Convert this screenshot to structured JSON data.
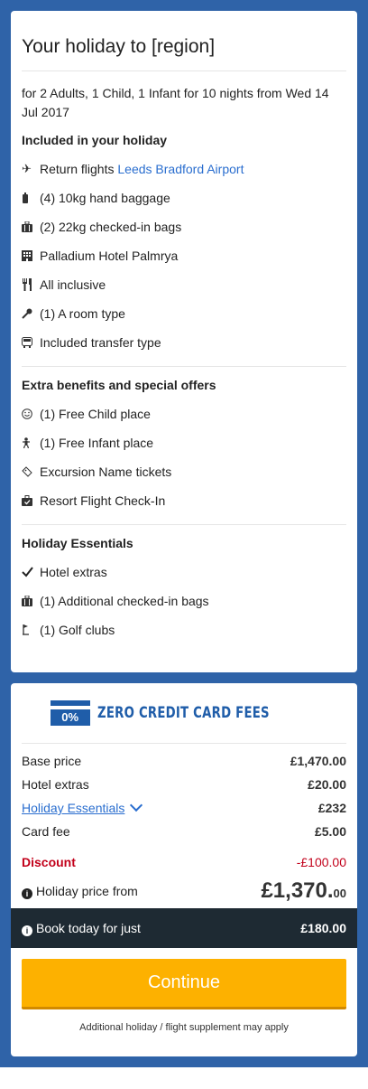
{
  "summary": {
    "title": "Your holiday to [region]",
    "intro": "for 2 Adults, 1 Child, 1 Infant for 10 nights from Wed 14 Jul 2017",
    "included_heading": "Included in your holiday",
    "included": [
      {
        "icon": "plane-icon",
        "text": "Return flights ",
        "link": "Leeds Bradford Airport"
      },
      {
        "icon": "hand-baggage-icon",
        "text": "(4) 10kg hand baggage"
      },
      {
        "icon": "suitcase-icon",
        "text": "(2) 22kg checked-in bags"
      },
      {
        "icon": "hotel-icon",
        "text": "Palladium Hotel Palmrya"
      },
      {
        "icon": "cutlery-icon",
        "text": "All inclusive"
      },
      {
        "icon": "key-icon",
        "text": "(1) A room type"
      },
      {
        "icon": "bus-icon",
        "text": "Included transfer type"
      }
    ],
    "extras_heading": "Extra benefits and special offers",
    "extras": [
      {
        "icon": "smiley-icon",
        "text": "(1) Free Child place"
      },
      {
        "icon": "baby-icon",
        "text": "(1) Free Infant place"
      },
      {
        "icon": "ticket-icon",
        "text": "Excursion Name tickets"
      },
      {
        "icon": "checkin-icon",
        "text": "Resort Flight Check-In"
      }
    ],
    "essentials_heading": "Holiday Essentials",
    "essentials": [
      {
        "icon": "checkmark-icon",
        "text": "Hotel extras"
      },
      {
        "icon": "suitcase-icon",
        "text": "(1) Additional checked-in bags"
      },
      {
        "icon": "golf-icon",
        "text": "(1) Golf clubs"
      }
    ]
  },
  "pricing": {
    "badge_percent": "0%",
    "badge_text": "ZERO CREDIT CARD FEES",
    "base_label": "Base price",
    "base_value": "£1,470.00",
    "hotel_label": "Hotel extras",
    "hotel_value": "£20.00",
    "essentials_label": "Holiday Essentials",
    "essentials_value": "£232",
    "card_label": "Card fee",
    "card_value": "£5.00",
    "discount_label": "Discount",
    "discount_value": "-£100.00",
    "holiday_label": "Holiday price from",
    "holiday_main": "£1,370.",
    "holiday_pence": "00",
    "book_label": "Book today for just",
    "book_value": "£180.00",
    "continue_label": "Continue",
    "note": "Additional holiday / flight supplement may apply"
  },
  "colors": {
    "background": "#2f63a8",
    "accent_button": "#fdb100",
    "discount": "#c2001a",
    "link": "#2a6ecf",
    "book_bar": "#1e2a33"
  }
}
